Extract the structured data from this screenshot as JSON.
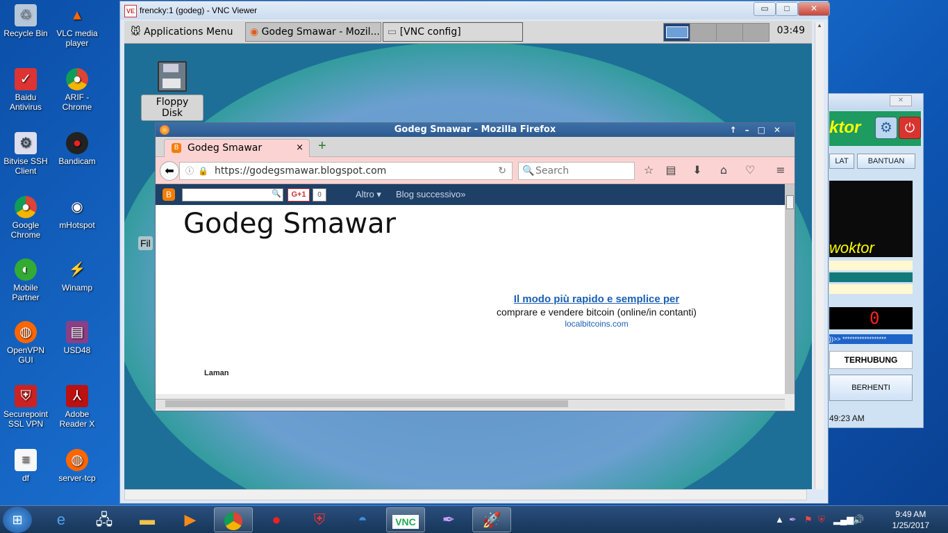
{
  "desktop_icons": [
    {
      "label": "Recycle Bin",
      "icon": "recycle-bin-icon"
    },
    {
      "label": "VLC media player",
      "icon": "vlc-icon"
    },
    {
      "label": "Baidu Antivirus",
      "icon": "shield-icon"
    },
    {
      "label": "ARIF - Chrome",
      "icon": "chrome-icon"
    },
    {
      "label": "Bitvise SSH Client",
      "icon": "ssh-icon"
    },
    {
      "label": "Bandicam",
      "icon": "record-icon"
    },
    {
      "label": "Google Chrome",
      "icon": "chrome-icon"
    },
    {
      "label": "mHotspot",
      "icon": "wifi-icon"
    },
    {
      "label": "Mobile Partner",
      "icon": "globe-icon"
    },
    {
      "label": "Winamp",
      "icon": "winamp-icon"
    },
    {
      "label": "OpenVPN GUI",
      "icon": "vpn-icon"
    },
    {
      "label": "USD48",
      "icon": "archive-icon"
    },
    {
      "label": "Securepoint SSL VPN",
      "icon": "shield-icon"
    },
    {
      "label": "Adobe Reader X",
      "icon": "pdf-icon"
    },
    {
      "label": "df",
      "icon": "file-icon"
    },
    {
      "label": "server-tcp",
      "icon": "vpn-icon"
    }
  ],
  "vnc": {
    "title": "frencky:1 (godeg) - VNC Viewer",
    "logo": "VE",
    "min": "▭",
    "max": "□",
    "close": "✕"
  },
  "xfce": {
    "apps_menu": "Applications Menu",
    "task1": "Godeg Smawar - Mozil...",
    "task2": "[VNC config]",
    "clock": "03:49",
    "floppy": "Floppy Disk",
    "partial_label": "Fil"
  },
  "firefox": {
    "title": "Godeg Smawar - Mozilla Firefox",
    "tab_label": "Godeg Smawar",
    "tab_close": "×",
    "new_tab": "+",
    "url": "https://godegsmawar.blogspot.com",
    "search_placeholder": "Search"
  },
  "blogger": {
    "gplus": "G+1",
    "gcount": "0",
    "menu_more": "Altro ▾",
    "menu_next": "Blog successivo»"
  },
  "page": {
    "blog_title": "Godeg Smawar",
    "ad_headline": "Il modo più rapido e semplice per",
    "ad_desc": "comprare e vendere bitcoin (online/in contanti)",
    "ad_url": "localbitcoins.com",
    "pages_label": "Laman"
  },
  "right_app": {
    "header_text": "ktor",
    "btn_left": "LAT",
    "btn_help": "BANTUAN",
    "banner_text": "woktor",
    "counter": "0",
    "stars": "})>> ******************",
    "status": "TERHUBUNG",
    "stop": "BERHENTI",
    "time": "49:23 AM"
  },
  "taskbar": {
    "time": "9:49 AM",
    "date": "1/25/2017"
  }
}
